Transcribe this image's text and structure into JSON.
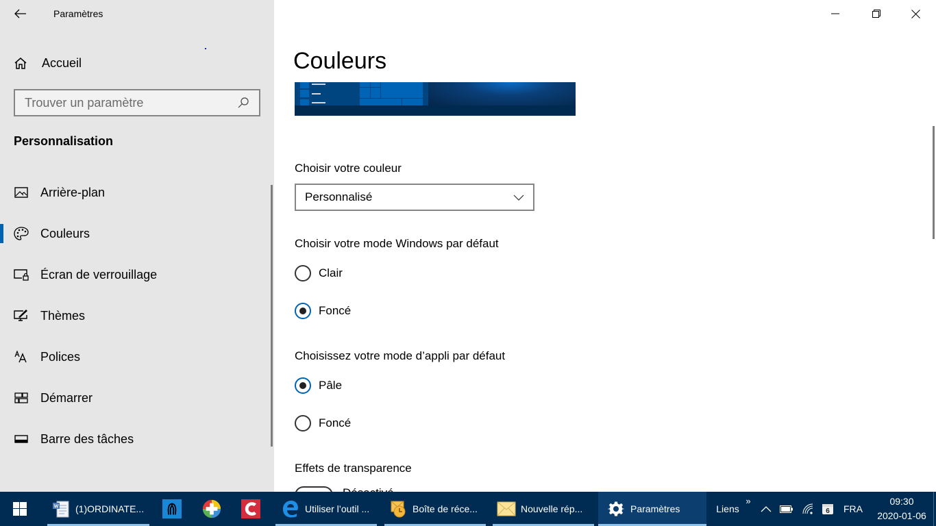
{
  "window": {
    "title": "Paramètres",
    "controls": {
      "minimize": "minimize",
      "maximize": "restore",
      "close": "close"
    }
  },
  "sidebar": {
    "home_label": "Accueil",
    "search": {
      "placeholder": "Trouver un paramètre",
      "value": ""
    },
    "section_title": "Personnalisation",
    "items": [
      {
        "label": "Arrière-plan",
        "icon": "picture-icon",
        "selected": false
      },
      {
        "label": "Couleurs",
        "icon": "palette-icon",
        "selected": true
      },
      {
        "label": "Écran de verrouillage",
        "icon": "lock-screen-icon",
        "selected": false
      },
      {
        "label": "Thèmes",
        "icon": "themes-icon",
        "selected": false
      },
      {
        "label": "Polices",
        "icon": "fonts-icon",
        "selected": false
      },
      {
        "label": "Démarrer",
        "icon": "start-icon",
        "selected": false
      },
      {
        "label": "Barre des tâches",
        "icon": "taskbar-icon",
        "selected": false
      }
    ]
  },
  "main": {
    "title": "Couleurs",
    "choose_color": {
      "label": "Choisir votre couleur",
      "selected": "Personnalisé"
    },
    "windows_mode": {
      "label": "Choisir votre mode Windows par défaut",
      "options": [
        {
          "label": "Clair",
          "checked": false
        },
        {
          "label": "Foncé",
          "checked": true
        }
      ]
    },
    "app_mode": {
      "label": "Choisissez votre mode d’appli par défaut",
      "options": [
        {
          "label": "Pâle",
          "checked": true
        },
        {
          "label": "Foncé",
          "checked": false
        }
      ]
    },
    "transparency": {
      "label": "Effets de transparence",
      "toggle_label": "Désactivé"
    }
  },
  "taskbar": {
    "apps": [
      {
        "label": "(1)ORDINATE...",
        "icon": "word-document-icon"
      },
      {
        "label": "",
        "icon": "app-blue-icon"
      },
      {
        "label": "",
        "icon": "app-colorful-circle-icon"
      },
      {
        "label": "",
        "icon": "app-red-c-icon"
      },
      {
        "label": "Utiliser l’outil ...",
        "icon": "edge-icon"
      },
      {
        "label": "Boîte de réce...",
        "icon": "outlook-icon"
      },
      {
        "label": "Nouvelle rép...",
        "icon": "mail-envelope-icon"
      },
      {
        "label": "Paramètres",
        "icon": "gear-icon"
      }
    ],
    "links_label": "Liens",
    "links_chevron": "»",
    "language": "FRA",
    "calendar_badge": "6",
    "time": "09:30",
    "date": "2020-01-06"
  },
  "colors": {
    "accent": "#0063b1",
    "sidebar_bg": "#e6e6e6",
    "taskbar_bg": "#002b52"
  }
}
